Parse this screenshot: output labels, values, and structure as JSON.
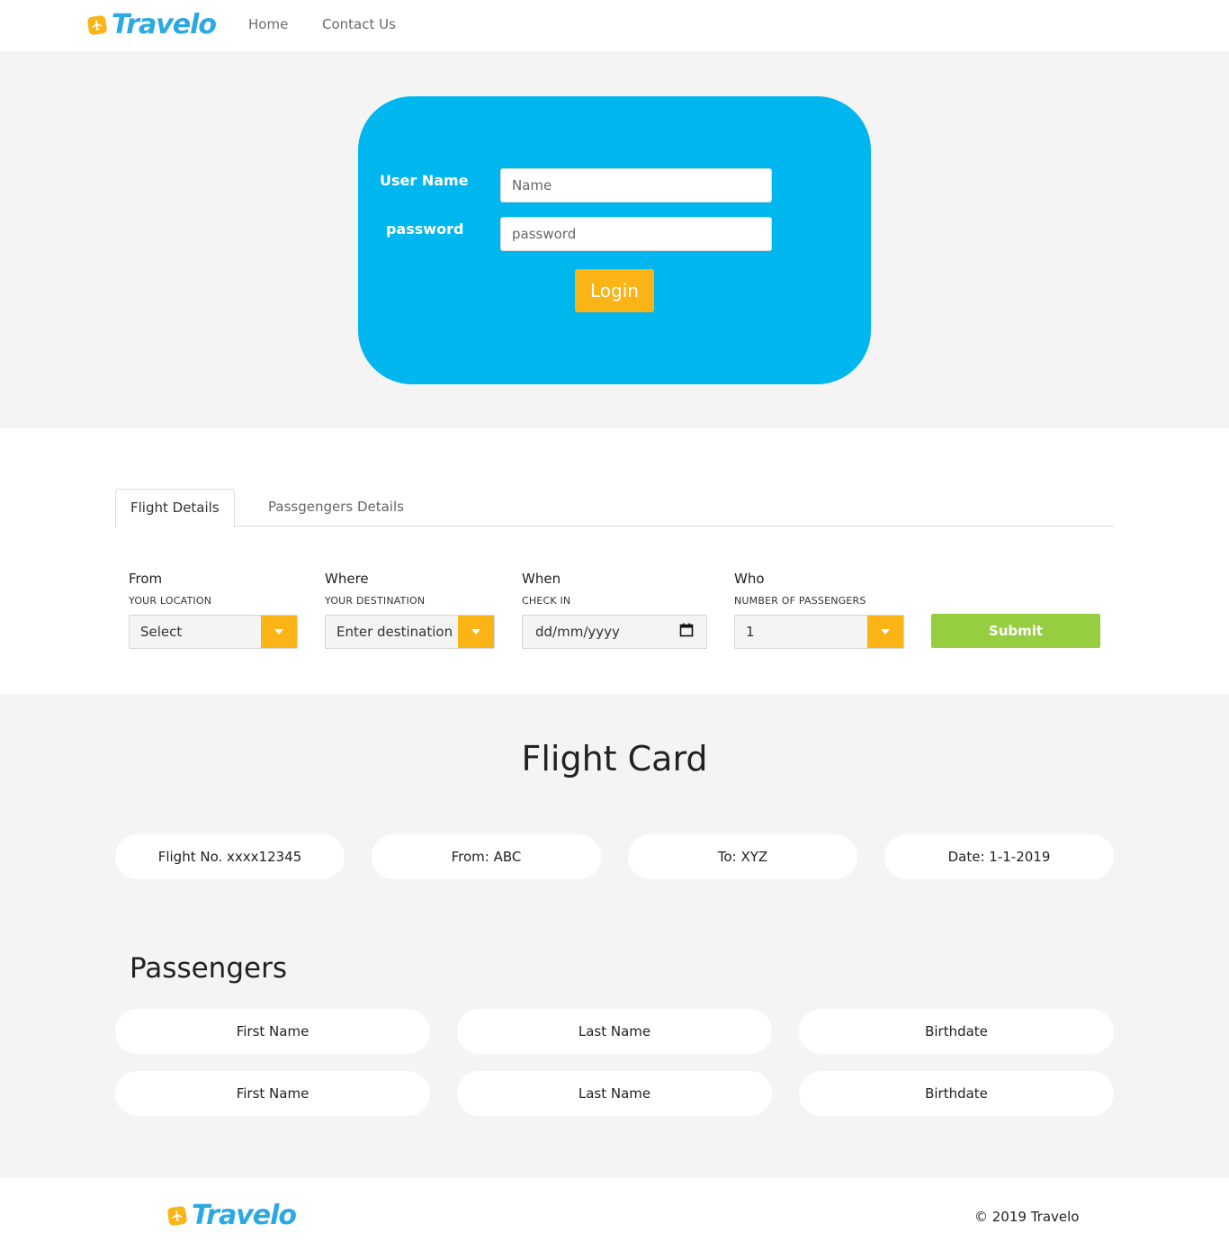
{
  "header": {
    "logo_text": "Travelo",
    "nav": [
      {
        "label": "Home"
      },
      {
        "label": "Contact Us"
      }
    ]
  },
  "login": {
    "username_label": "User Name",
    "username_placeholder": "Name",
    "password_label": "password",
    "password_placeholder": "password",
    "login_button": "Login"
  },
  "tabs": [
    {
      "label": "Flight Details",
      "active": true
    },
    {
      "label": "Passgengers Details",
      "active": false
    }
  ],
  "search": {
    "from": {
      "title": "From",
      "sub": "YOUR LOCATION",
      "value": "Select"
    },
    "where": {
      "title": "Where",
      "sub": "YOUR DESTINATION",
      "value": "Enter destination"
    },
    "when": {
      "title": "When",
      "sub": "CHECK IN",
      "value": "dd/mm/yyyy"
    },
    "who": {
      "title": "Who",
      "sub": "NUMBER OF PASSENGERS",
      "value": "1"
    },
    "submit_label": "Submit"
  },
  "flight_card": {
    "title": "Flight Card",
    "flight_no": "Flight No. xxxx12345",
    "from": "From: ABC",
    "to": "To: XYZ",
    "date": "Date: 1-1-2019"
  },
  "passengers": {
    "title": "Passengers",
    "rows": [
      {
        "first": "First Name",
        "last": "Last Name",
        "birth": "Birthdate"
      },
      {
        "first": "First Name",
        "last": "Last Name",
        "birth": "Birthdate"
      }
    ]
  },
  "footer": {
    "logo_text": "Travelo",
    "copyright": "© 2019 Travelo"
  },
  "colors": {
    "brand_blue": "#2aa9e2",
    "login_card": "#00b6ef",
    "accent_yellow": "#fbb415",
    "submit_green": "#97cd40"
  }
}
